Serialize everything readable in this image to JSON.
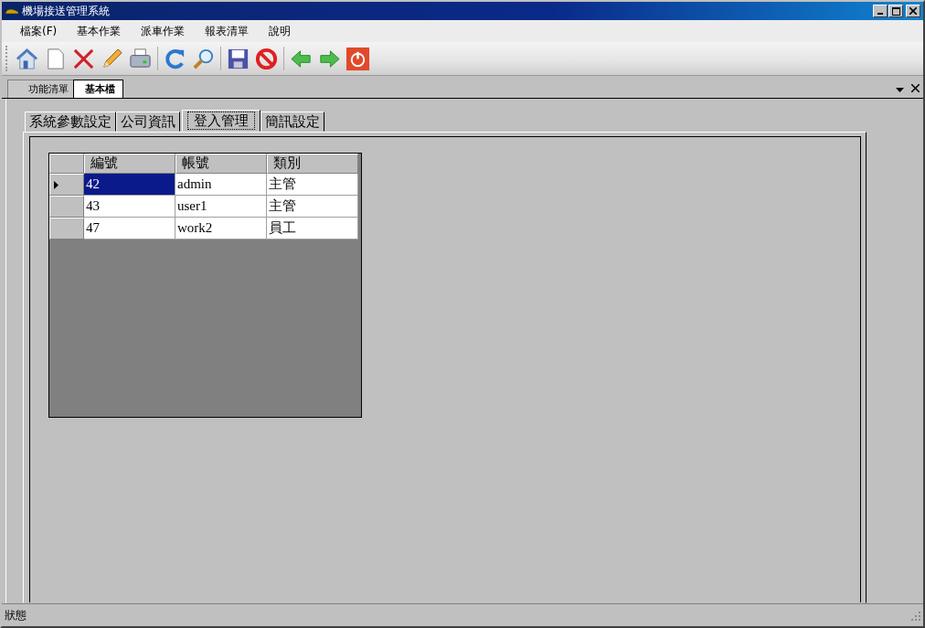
{
  "window": {
    "title": "機場接送管理系統"
  },
  "menu": [
    "檔案(F)",
    "基本作業",
    "派車作業",
    "報表清單",
    "說明"
  ],
  "doc_tabs": [
    {
      "label": "功能清單",
      "selected": false
    },
    {
      "label": "基本檔",
      "selected": true
    }
  ],
  "tabs": [
    {
      "label": "系統參數設定",
      "selected": false
    },
    {
      "label": "公司資訊",
      "selected": false
    },
    {
      "label": "登入管理",
      "selected": true
    },
    {
      "label": "簡訊設定",
      "selected": false
    }
  ],
  "table": {
    "columns": [
      "編號",
      "帳號",
      "類別"
    ],
    "rows": [
      {
        "cells": [
          "42",
          "admin",
          "主管"
        ],
        "selected": true
      },
      {
        "cells": [
          "43",
          "user1",
          "主管"
        ],
        "selected": false
      },
      {
        "cells": [
          "47",
          "work2",
          "員工"
        ],
        "selected": false
      }
    ]
  },
  "status_bar": "狀態"
}
